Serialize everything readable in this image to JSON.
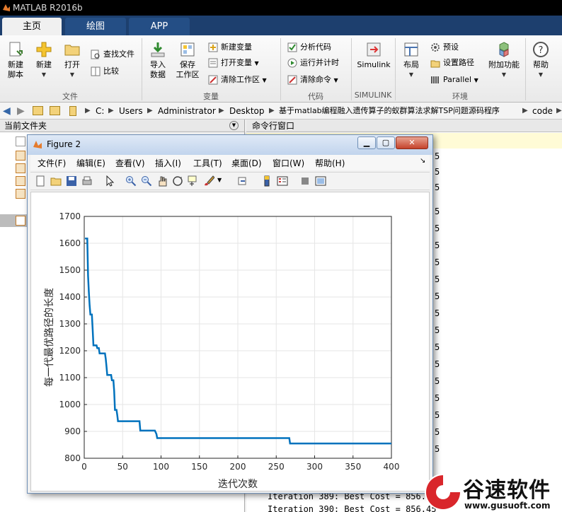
{
  "app": {
    "title": "MATLAB R2016b"
  },
  "tabs": [
    {
      "label": "主页",
      "active": true
    },
    {
      "label": "绘图",
      "active": false
    },
    {
      "label": "APP",
      "active": false
    }
  ],
  "ribbon": {
    "groups": {
      "file": "文件",
      "variable": "变量",
      "code": "代码",
      "simulink": "SIMULINK",
      "environment": "环境"
    },
    "new_script_line1": "新建",
    "new_script_line2": "脚本",
    "new": "新建",
    "open": "打开",
    "find_files": "查找文件",
    "compare": "比较",
    "import_line1": "导入",
    "import_line2": "数据",
    "save_ws_line1": "保存",
    "save_ws_line2": "工作区",
    "new_variable": "新建变量",
    "open_variable": "打开变量",
    "clear_workspace": "清除工作区",
    "analyze_code": "分析代码",
    "run_time": "运行并计时",
    "clear_commands": "清除命令",
    "simulink": "Simulink",
    "layout": "布局",
    "preferences": "预设",
    "set_path": "设置路径",
    "parallel": "Parallel",
    "addons": "附加功能",
    "help": "帮助"
  },
  "address": {
    "crumbs": [
      "C:",
      "Users",
      "Administrator",
      "Desktop",
      "基于matlab编程融入遗传算子的蚁群算法求解TSP问题源码程序",
      "code"
    ]
  },
  "panels": {
    "current_folder": "当前文件夹",
    "command_window": "命令行窗口"
  },
  "command_window": {
    "lines": [
      "Iteration 389: Best Cost = 856.4",
      "Iteration 390: Best Cost = 856.45"
    ],
    "bg_digit": "5"
  },
  "figure": {
    "title": "Figure 2",
    "menu": [
      "文件(F)",
      "编辑(E)",
      "查看(V)",
      "插入(I)",
      "工具(T)",
      "桌面(D)",
      "窗口(W)",
      "帮助(H)"
    ]
  },
  "chart_data": {
    "type": "line",
    "xlabel": "迭代次数",
    "ylabel": "每一代最优路径的长度",
    "xlim": [
      0,
      400
    ],
    "ylim": [
      800,
      1700
    ],
    "xticks": [
      0,
      50,
      100,
      150,
      200,
      250,
      300,
      350,
      400
    ],
    "yticks": [
      800,
      900,
      1000,
      1100,
      1200,
      1300,
      1400,
      1500,
      1600,
      1700
    ],
    "grid": true,
    "line_color": "#0072bd",
    "series": [
      {
        "x": [
          1,
          4,
          5,
          6,
          7,
          8,
          10,
          11,
          12,
          16,
          17,
          19,
          20,
          27,
          28,
          29,
          30,
          35,
          36,
          38,
          39,
          40,
          42,
          43,
          44,
          72,
          73,
          92,
          94,
          95,
          267,
          268,
          400
        ],
        "y": [
          1618,
          1618,
          1480,
          1420,
          1370,
          1335,
          1335,
          1280,
          1220,
          1220,
          1210,
          1210,
          1190,
          1190,
          1170,
          1140,
          1110,
          1110,
          1090,
          1090,
          1050,
          980,
          980,
          960,
          938,
          938,
          903,
          903,
          890,
          875,
          875,
          855,
          855
        ]
      }
    ]
  },
  "watermark": {
    "name": "谷速软件",
    "url": "www.gusuoft.com"
  }
}
